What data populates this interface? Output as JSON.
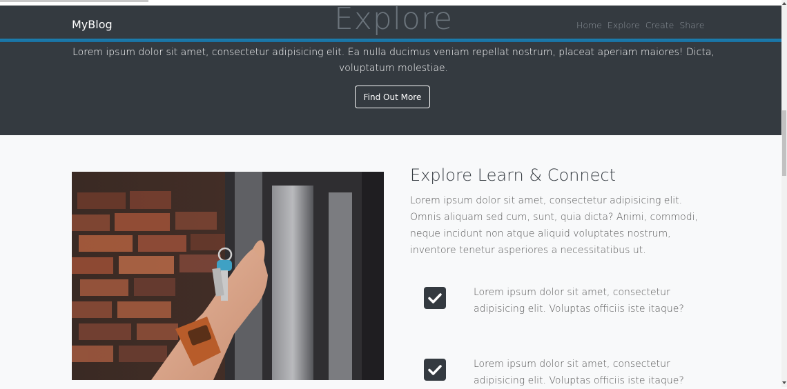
{
  "navbar": {
    "brand": "MyBlog",
    "links": [
      "Home",
      "Explore",
      "Create",
      "Share"
    ]
  },
  "hero": {
    "title": "Explore",
    "text": "Lorem ipsum dolor sit amet, consectetur adipisicing elit. Ea nulla ducimus veniam repellat nostrum, placeat aperiam maiores! Dicta, voluptatum molestiae.",
    "button_label": "Find Out More"
  },
  "section": {
    "title": "Explore Learn & Connect",
    "text": "Lorem ipsum dolor sit amet, consectetur adipisicing elit. Omnis aliquam sed cum, sunt, quia dicta? Animi, commodi, neque incidunt non atque aliquid voluptates nostrum, inventore tenetur asperiores a necessitatibus ut.",
    "features": [
      {
        "icon": "check-square-icon",
        "text": "Lorem ipsum dolor sit amet, consectetur adipisicing elit. Voluptas officiis iste itaque?"
      },
      {
        "icon": "check-square-icon",
        "text": "Lorem ipsum dolor sit amet, consectetur adipisicing elit. Voluptas officiis iste itaque?"
      }
    ]
  },
  "colors": {
    "dark": "#343a40",
    "accent_line": "#1b7fb0",
    "light_bg": "#f8f9fa"
  }
}
